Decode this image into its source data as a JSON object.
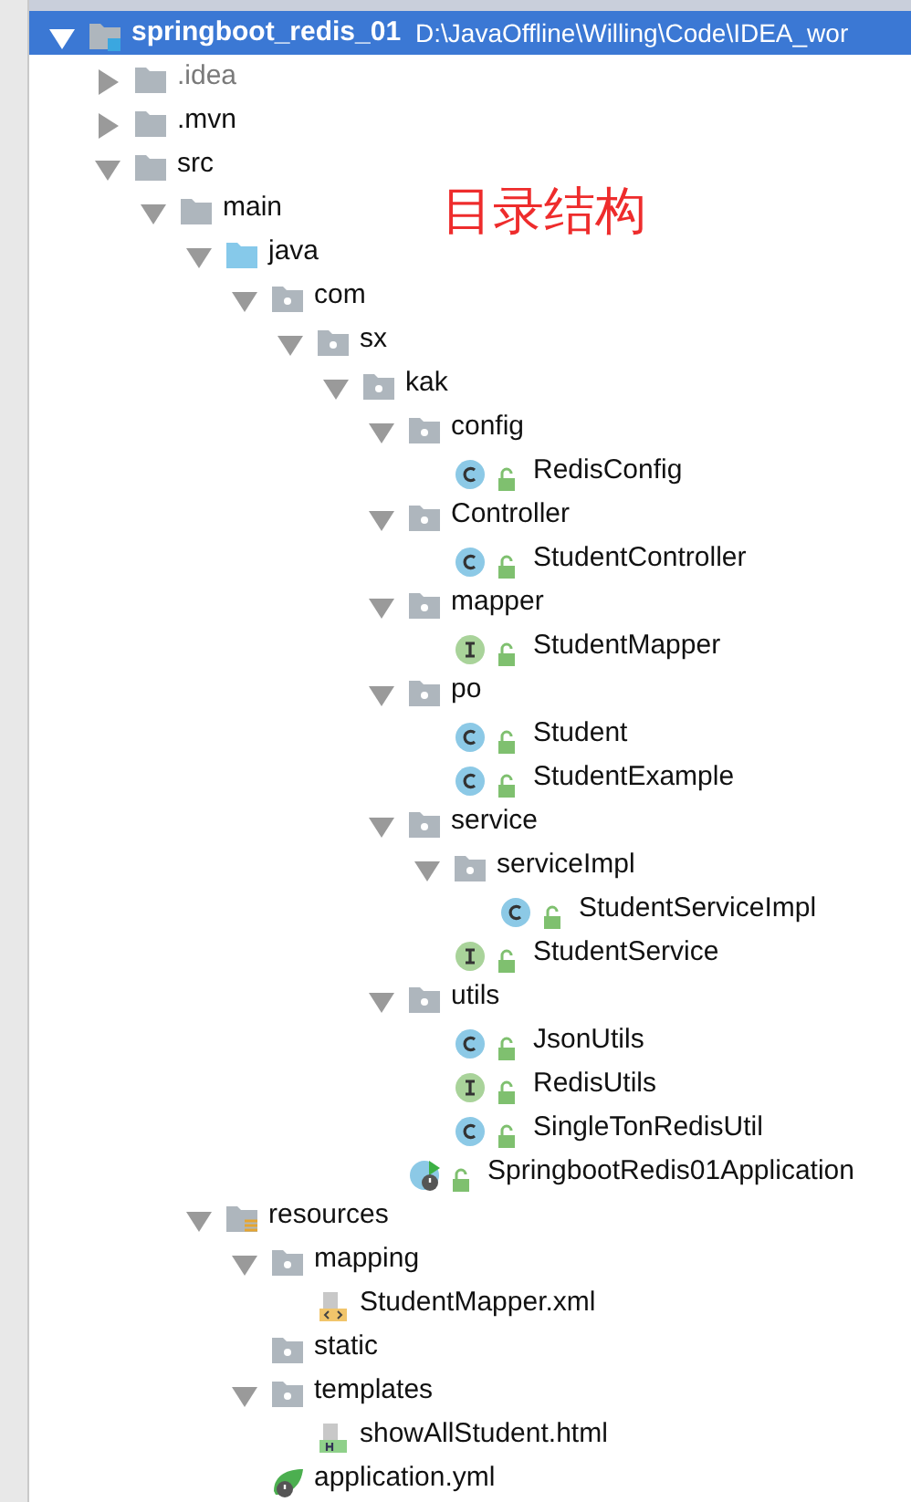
{
  "annotation": "目录结构",
  "tree": [
    {
      "kind": "project",
      "label": "springboot_redis_01",
      "path": "D:\\JavaOffline\\Willing\\Code\\IDEA_wor",
      "selected": true,
      "expanded": true,
      "children": [
        {
          "kind": "folder",
          "label": ".idea",
          "excluded": true,
          "expanded": false,
          "selected": false
        },
        {
          "kind": "folder",
          "label": ".mvn",
          "expanded": false,
          "selected": false
        },
        {
          "kind": "folder",
          "label": "src",
          "expanded": true,
          "selected": false,
          "children": [
            {
              "kind": "folder",
              "label": "main",
              "expanded": true,
              "selected": false,
              "children": [
                {
                  "kind": "source",
                  "label": "java",
                  "expanded": true,
                  "selected": false,
                  "children": [
                    {
                      "kind": "package",
                      "label": "com",
                      "expanded": true,
                      "selected": false,
                      "children": [
                        {
                          "kind": "package",
                          "label": "sx",
                          "expanded": true,
                          "selected": false,
                          "children": [
                            {
                              "kind": "package",
                              "label": "kak",
                              "expanded": true,
                              "selected": false,
                              "children": [
                                {
                                  "kind": "package",
                                  "label": "config",
                                  "expanded": true,
                                  "selected": false,
                                  "children": [
                                    {
                                      "kind": "class",
                                      "label": "RedisConfig",
                                      "selected": false
                                    }
                                  ]
                                },
                                {
                                  "kind": "package",
                                  "label": "Controller",
                                  "expanded": true,
                                  "selected": false,
                                  "children": [
                                    {
                                      "kind": "class",
                                      "label": "StudentController",
                                      "selected": false
                                    }
                                  ]
                                },
                                {
                                  "kind": "package",
                                  "label": "mapper",
                                  "expanded": true,
                                  "selected": false,
                                  "children": [
                                    {
                                      "kind": "interface",
                                      "label": "StudentMapper",
                                      "selected": false
                                    }
                                  ]
                                },
                                {
                                  "kind": "package",
                                  "label": "po",
                                  "expanded": true,
                                  "selected": false,
                                  "children": [
                                    {
                                      "kind": "class",
                                      "label": "Student",
                                      "selected": false
                                    },
                                    {
                                      "kind": "class",
                                      "label": "StudentExample",
                                      "selected": false
                                    }
                                  ]
                                },
                                {
                                  "kind": "package",
                                  "label": "service",
                                  "expanded": true,
                                  "selected": false,
                                  "children": [
                                    {
                                      "kind": "package",
                                      "label": "serviceImpl",
                                      "expanded": true,
                                      "selected": false,
                                      "children": [
                                        {
                                          "kind": "class",
                                          "label": "StudentServiceImpl",
                                          "selected": false
                                        }
                                      ]
                                    },
                                    {
                                      "kind": "interface",
                                      "label": "StudentService",
                                      "selected": false
                                    }
                                  ]
                                },
                                {
                                  "kind": "package",
                                  "label": "utils",
                                  "expanded": true,
                                  "selected": false,
                                  "children": [
                                    {
                                      "kind": "class",
                                      "label": "JsonUtils",
                                      "selected": false
                                    },
                                    {
                                      "kind": "interface",
                                      "label": "RedisUtils",
                                      "selected": false
                                    },
                                    {
                                      "kind": "class",
                                      "label": "SingleTonRedisUtil",
                                      "selected": false
                                    }
                                  ]
                                },
                                {
                                  "kind": "app",
                                  "label": "SpringbootRedis01Application",
                                  "selected": false
                                }
                              ]
                            }
                          ]
                        }
                      ]
                    }
                  ]
                },
                {
                  "kind": "resources",
                  "label": "resources",
                  "expanded": true,
                  "selected": false,
                  "children": [
                    {
                      "kind": "package",
                      "label": "mapping",
                      "expanded": true,
                      "selected": false,
                      "children": [
                        {
                          "kind": "xml",
                          "label": "StudentMapper.xml",
                          "selected": false
                        }
                      ]
                    },
                    {
                      "kind": "package",
                      "label": "static",
                      "selected": false
                    },
                    {
                      "kind": "package",
                      "label": "templates",
                      "expanded": true,
                      "selected": false,
                      "children": [
                        {
                          "kind": "html",
                          "label": "showAllStudent.html",
                          "selected": false
                        }
                      ]
                    },
                    {
                      "kind": "yml",
                      "label": "application.yml",
                      "selected": false
                    }
                  ]
                }
              ]
            }
          ]
        }
      ]
    }
  ]
}
